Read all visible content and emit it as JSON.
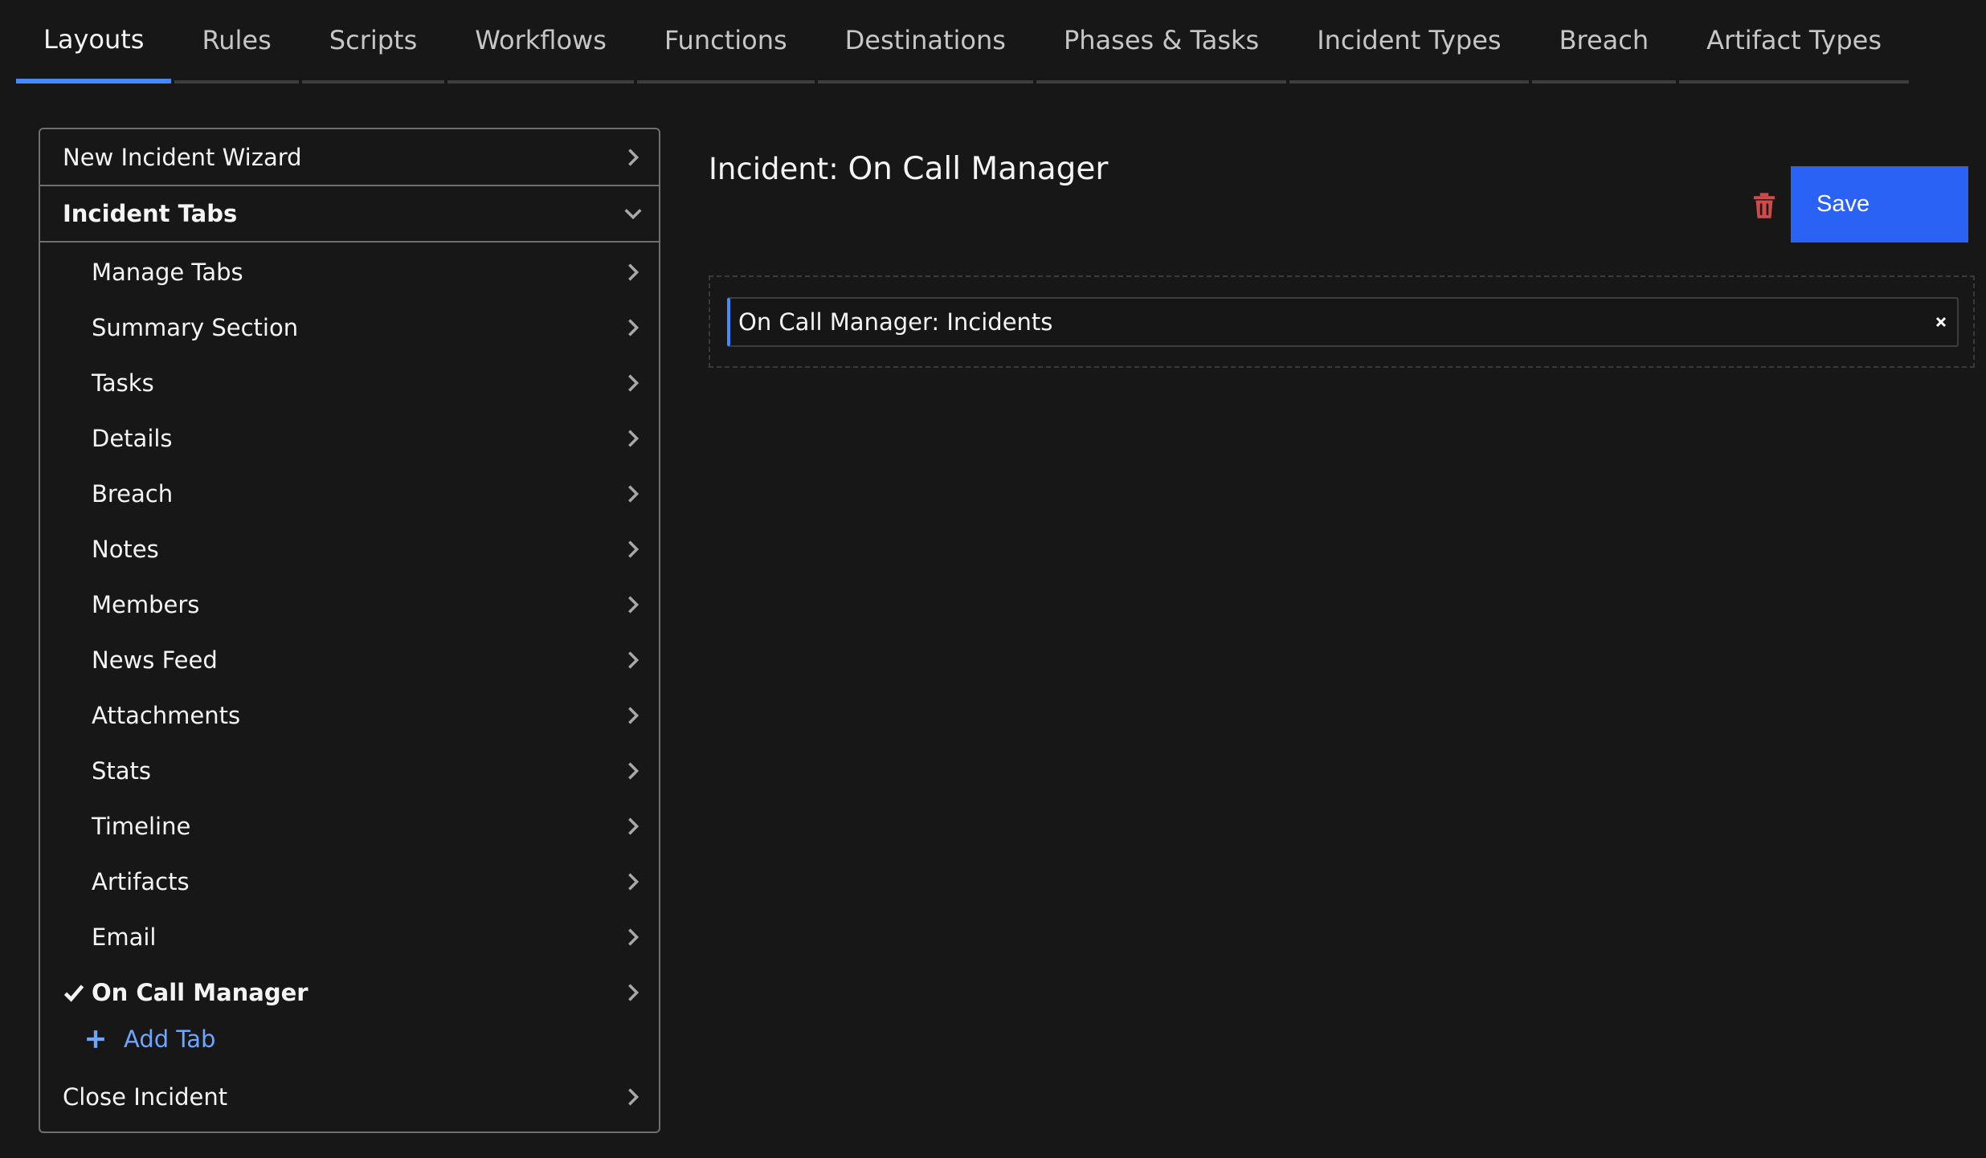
{
  "tabs": [
    {
      "label": "Layouts",
      "active": true
    },
    {
      "label": "Rules"
    },
    {
      "label": "Scripts"
    },
    {
      "label": "Workflows"
    },
    {
      "label": "Functions"
    },
    {
      "label": "Destinations"
    },
    {
      "label": "Phases & Tasks"
    },
    {
      "label": "Incident Types"
    },
    {
      "label": "Breach"
    },
    {
      "label": "Artifact Types"
    }
  ],
  "sidebar": {
    "new_incident_wizard": "New Incident Wizard",
    "incident_tabs": "Incident Tabs",
    "items": [
      {
        "label": "Manage Tabs"
      },
      {
        "label": "Summary Section"
      },
      {
        "label": "Tasks"
      },
      {
        "label": "Details"
      },
      {
        "label": "Breach"
      },
      {
        "label": "Notes"
      },
      {
        "label": "Members"
      },
      {
        "label": "News Feed"
      },
      {
        "label": "Attachments"
      },
      {
        "label": "Stats"
      },
      {
        "label": "Timeline"
      },
      {
        "label": "Artifacts"
      },
      {
        "label": "Email"
      },
      {
        "label": "On Call Manager",
        "selected": true
      }
    ],
    "add_tab": "Add Tab",
    "close_incident": "Close Incident"
  },
  "main": {
    "title_prefix": "Incident:",
    "title_name": "On Call Manager",
    "save_label": "Save",
    "fields": [
      {
        "label": "On Call Manager: Incidents"
      }
    ]
  },
  "icons": {
    "chevron_right": "chevron-right-icon",
    "chevron_down": "chevron-down-icon",
    "check": "checkmark-icon",
    "plus": "plus-icon",
    "trash": "trash-icon",
    "close": "close-icon"
  },
  "colors": {
    "background": "#171717",
    "accent": "#4589ff",
    "save_button": "#2962f5",
    "delete_icon": "#d04a4a",
    "link": "#6ea6ff"
  }
}
